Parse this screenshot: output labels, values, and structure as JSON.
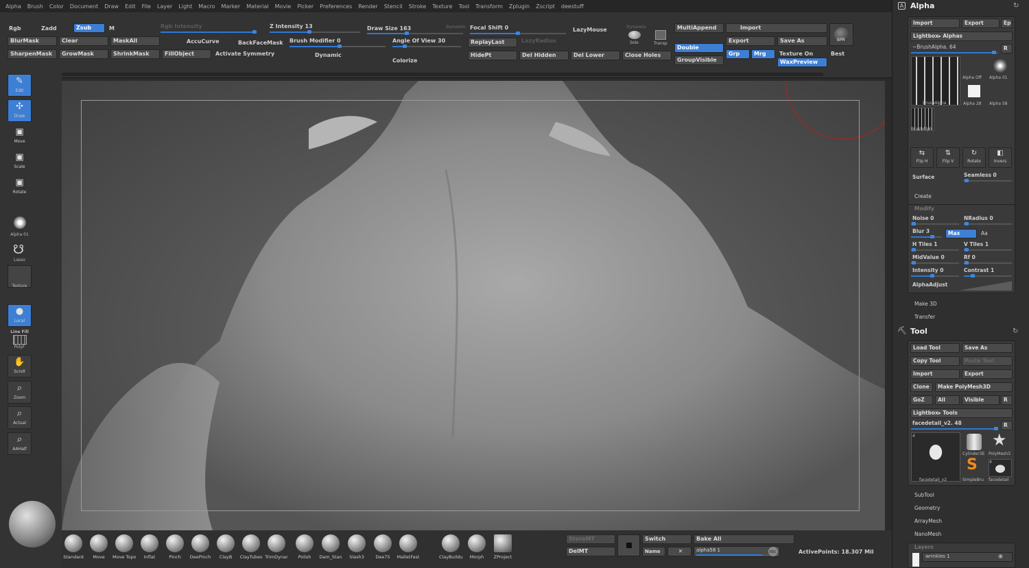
{
  "menu": [
    "Alpha",
    "Brush",
    "Color",
    "Document",
    "Draw",
    "Edit",
    "File",
    "Layer",
    "Light",
    "Macro",
    "Marker",
    "Material",
    "Movie",
    "Picker",
    "Preferences",
    "Render",
    "Stencil",
    "Stroke",
    "Texture",
    "Tool",
    "Transform",
    "Zplugin",
    "Zscript",
    "deestuff"
  ],
  "top": {
    "rgb": "Rgb",
    "zadd": "Zadd",
    "zsub": "Zsub",
    "m": "M",
    "rgb_intensity": "Rgb Intensity",
    "z_intensity": "Z Intensity 13",
    "draw_size": "Draw Size 163",
    "dynamic_small": "Dynamic",
    "focal_shift": "Focal Shift 0",
    "lazymouse": "LazyMouse",
    "dynamic_label": "Dynamic",
    "solo": "Solo",
    "transp": "Transp",
    "multiappend": "MultiAppend",
    "import": "Import",
    "blurmask": "BlurMask",
    "clear": "Clear",
    "maskall": "MaskAll",
    "accucurve": "AccuCurve",
    "backfacemask": "BackFaceMask",
    "brush_modifier": "Brush Modifier 0",
    "angle_of_view": "Angle Of View 30",
    "replaylast": "ReplayLast",
    "lazyradius": "LazyRadius",
    "double": "Double",
    "export": "Export",
    "save_as": "Save As",
    "bpr": "BPR",
    "sharpenmask": "SharpenMask",
    "growmask": "GrowMask",
    "shrinkmask": "ShrinkMask",
    "fillobject": "FillObject",
    "activate_symmetry": "Activate Symmetry",
    "dynamic_btn": "Dynamic",
    "colorize": "Colorize",
    "hidept": "HidePt",
    "del_hidden": "Del Hidden",
    "del_lower": "Del Lower",
    "close_holes": "Close Holes",
    "groupvisible": "GroupVisible",
    "grp": "Grp",
    "mrg": "Mrg",
    "texture_on": "Texture On",
    "best": "Best",
    "waxpreview": "WaxPreview",
    "sliders": {
      "z_intensity": 0.13,
      "draw_size": 0.16,
      "focal_shift": 0.5,
      "brush_modifier": 0.0,
      "angle_of_view": 0.3
    }
  },
  "left": {
    "edit": "Edit",
    "draw": "Draw",
    "move": "Move",
    "scale": "Scale",
    "rotate": "Rotate",
    "alpha": "Alpha 01",
    "lasso": "Lasso",
    "texture": "Texture",
    "local": "Local",
    "linefill": "Line Fill",
    "polyf": "PolyF",
    "scroll": "Scroll",
    "zoom": "Zoom",
    "actual": "Actual",
    "aahalf": "AAHalf"
  },
  "brushes": [
    "Standard",
    "Move",
    "Move Topo",
    "Inflat",
    "Pinch",
    "DeePinch",
    "ClayB",
    "ClayTubes",
    "TrimDynar",
    "Polish",
    "Dam_Stan",
    "Slash3",
    "Dee75",
    "MalletFast",
    "ClayBuildup",
    "Morph",
    "ZProject"
  ],
  "bottom": {
    "storemt": "StoreMT",
    "delmt": "DelMT",
    "switch": "Switch",
    "bake_all": "Bake All",
    "name": "Name",
    "layer_field": "alpha58 1",
    "rec": "REC",
    "active_points": "ActivePoints: 18.307 Mil"
  },
  "alpha": {
    "title": "Alpha",
    "import": "Import",
    "export": "Export",
    "ep": "Ep",
    "lightbox": "Lightbox▸ Alphas",
    "current": "~BrushAlpha. 64",
    "r": "R",
    "big_label": "BrushAlpha",
    "alpha_off": "Alpha Off",
    "alpha01": "Alpha 01",
    "alpha28": "Alpha 28",
    "alpha58": "Alpha 58",
    "brushalph": "BrushAlph",
    "flip_h": "Flip H",
    "flip_v": "Flip V",
    "rotate": "Rotate",
    "invers": "Invers",
    "surface": "Surface",
    "seamless": "Seamless 0",
    "create": "Create",
    "modify": "Modify",
    "noise": "Noise 0",
    "nradius": "NRadius 0",
    "blur": "Blur 3",
    "max": "Max",
    "aa": "Aa",
    "htiles": "H Tiles 1",
    "vtiles": "V Tiles 1",
    "midvalue": "MidValue 0",
    "rf": "Rf 0",
    "intensity": "Intensity 0",
    "contrast": "Contrast 1",
    "alphaadjust": "AlphaAdjust",
    "make3d": "Make 3D",
    "transfer": "Transfer"
  },
  "tool": {
    "title": "Tool",
    "load_tool": "Load Tool",
    "save_as": "Save As",
    "copy_tool": "Copy Tool",
    "paste_tool": "Paste Tool",
    "import": "Import",
    "export": "Export",
    "clone": "Clone",
    "make_polymesh": "Make PolyMesh3D",
    "goz": "GoZ",
    "all": "All",
    "visible": "Visible",
    "r": "R",
    "lightbox": "Lightbox▸ Tools",
    "current": "facedetail_v2. 48",
    "big_label": "facedetail_v2",
    "count": "4",
    "cylinder": "Cylinder3E",
    "polymesh": "PolyMesh3",
    "simplebrush": "SimpleBru",
    "facedetail": "facedetail",
    "subtool": "SubTool",
    "geometry": "Geometry",
    "arraymesh": "ArrayMesh",
    "nanomesh": "NanoMesh",
    "layers": "Layers",
    "layer_item": "wrinkles 1"
  },
  "colors": {
    "accent": "#3d7fd4"
  }
}
